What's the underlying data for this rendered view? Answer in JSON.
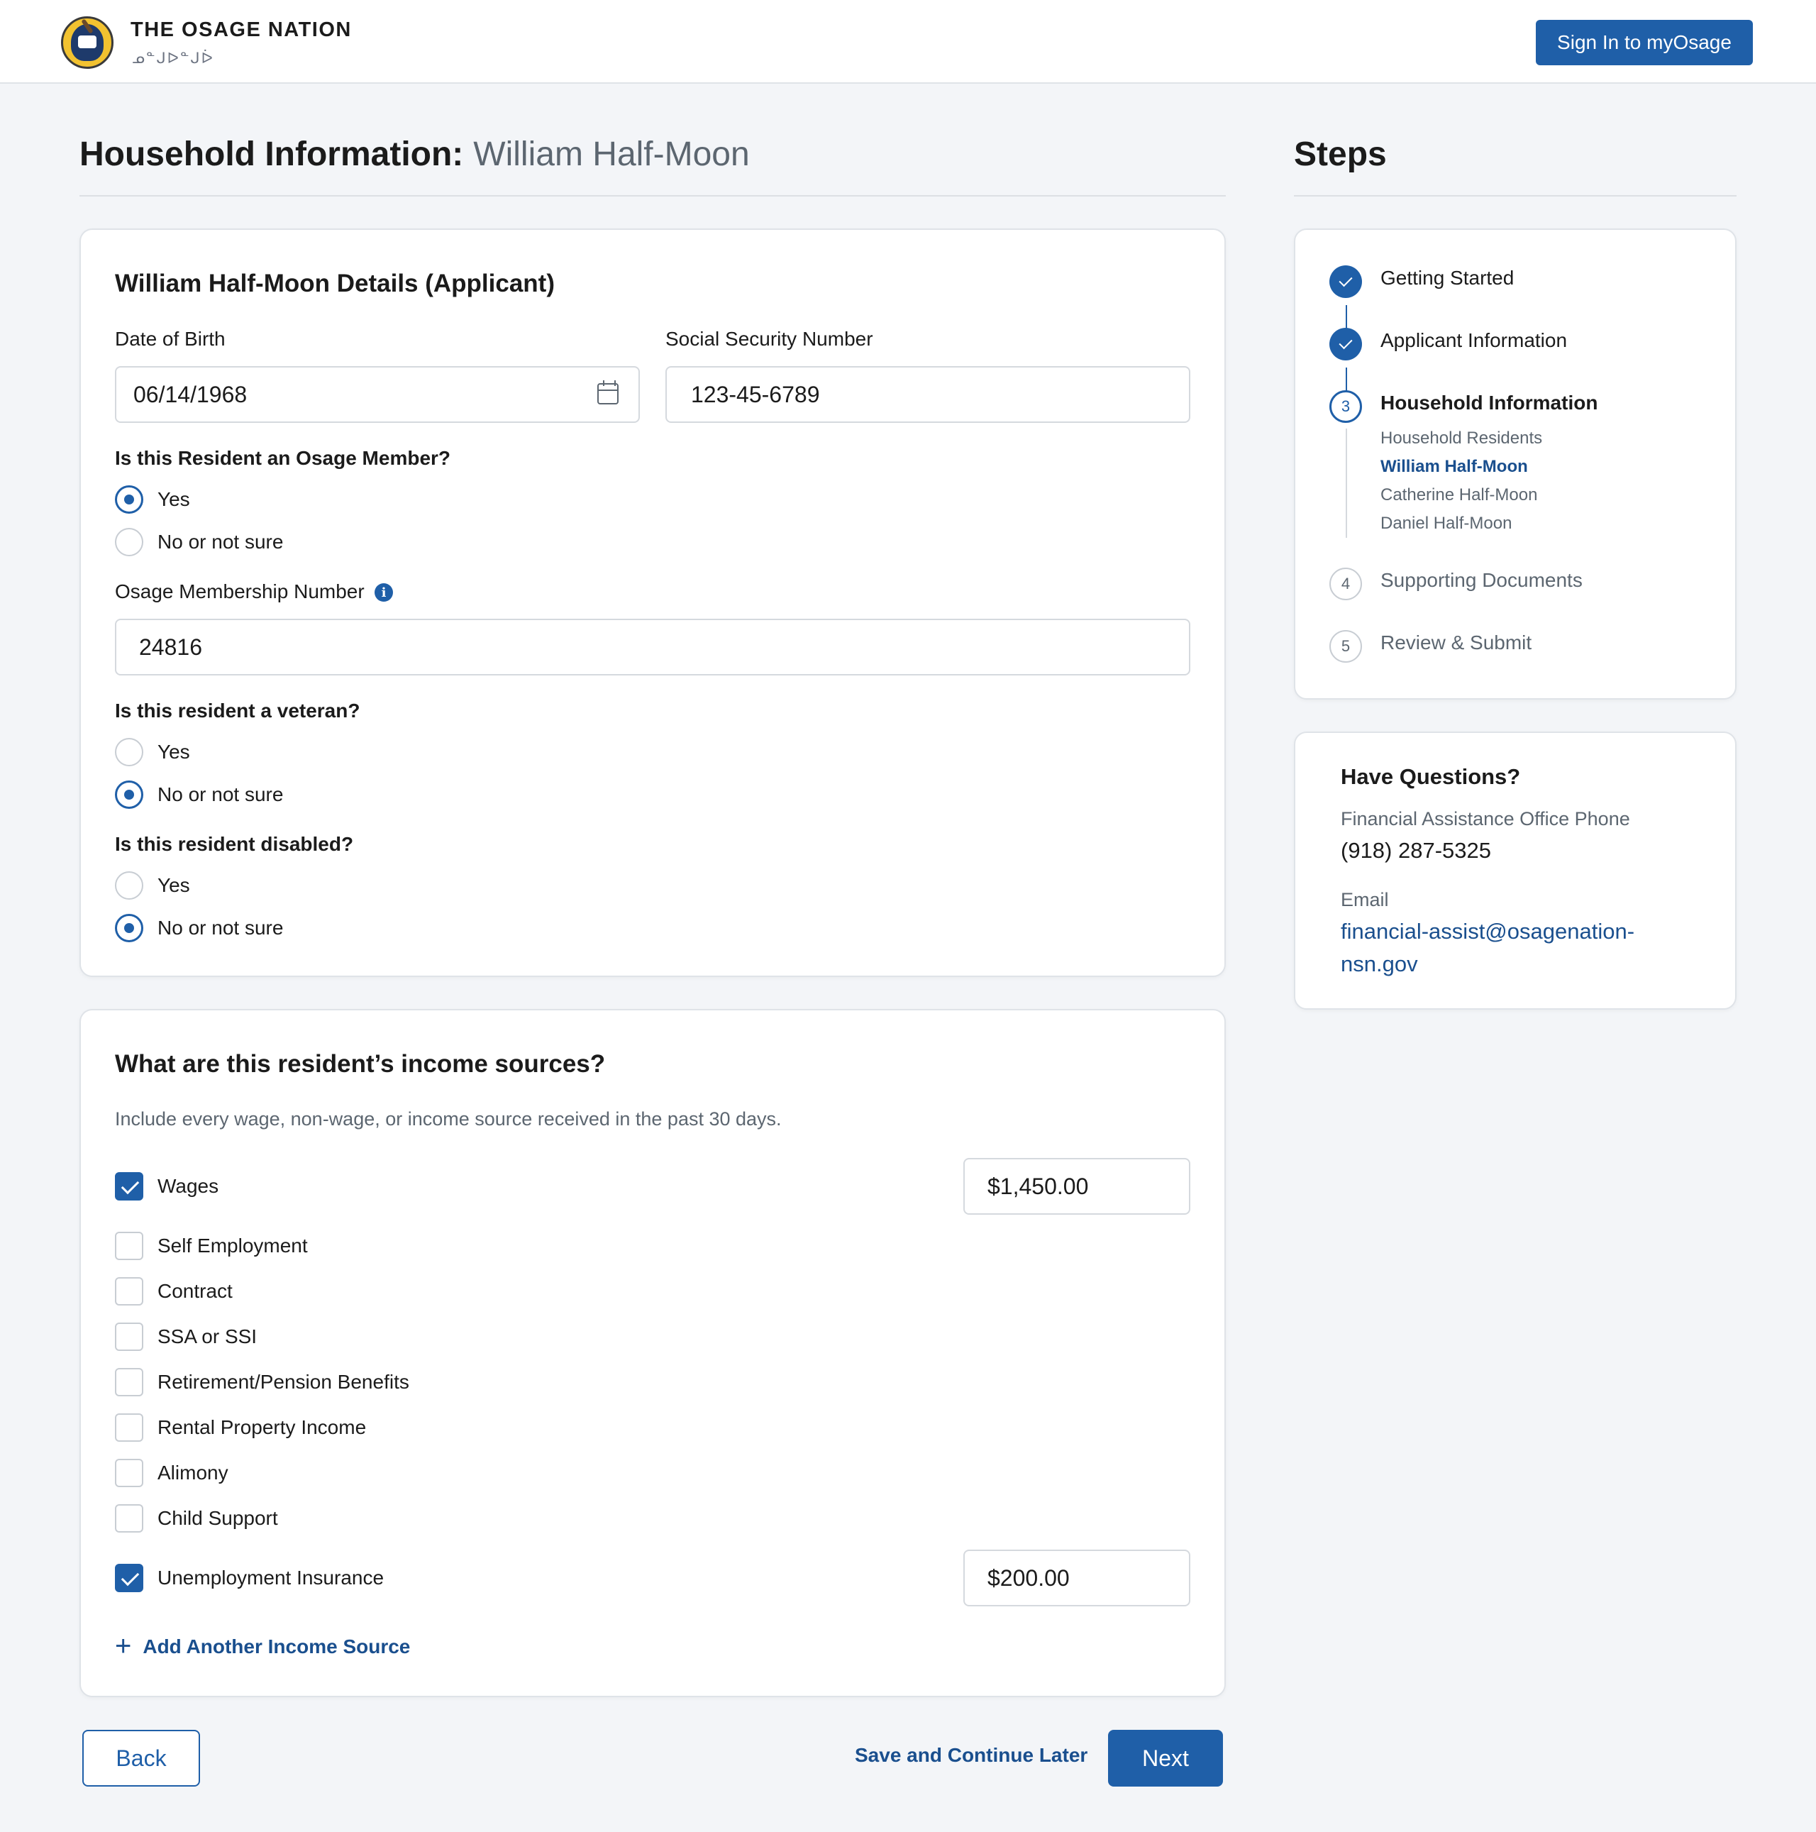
{
  "header": {
    "brand_name": "THE OSAGE NATION",
    "brand_sub": "ᓄᓐᒍᐅᓐᒍᐆ",
    "signin_label": "Sign In to myOsage"
  },
  "page": {
    "title": "Household Information:",
    "resident_name": "William Half-Moon",
    "steps_title": "Steps"
  },
  "details": {
    "heading": "William Half-Moon Details (Applicant)",
    "dob_label": "Date of Birth",
    "dob_value": "06/14/1968",
    "ssn_label": "Social Security Number",
    "ssn_value": "123-45-6789",
    "osage_question": "Is this Resident an Osage Member?",
    "opt_yes": "Yes",
    "opt_no": "No or not sure",
    "membership_label": "Osage Membership Number",
    "membership_value": "24816",
    "veteran_question": "Is this resident a veteran?",
    "disabled_question": "Is this resident disabled?"
  },
  "income": {
    "heading": "What are this resident’s income sources?",
    "hint": "Include every wage, non-wage, or income source received in the past 30 days.",
    "sources": [
      {
        "label": "Wages",
        "checked": true,
        "amount": "$1,450.00"
      },
      {
        "label": "Self Employment",
        "checked": false
      },
      {
        "label": "Contract",
        "checked": false
      },
      {
        "label": "SSA or SSI",
        "checked": false
      },
      {
        "label": "Retirement/Pension Benefits",
        "checked": false
      },
      {
        "label": "Rental Property Income",
        "checked": false
      },
      {
        "label": "Alimony",
        "checked": false
      },
      {
        "label": "Child Support",
        "checked": false
      },
      {
        "label": "Unemployment Insurance",
        "checked": true,
        "amount": "$200.00"
      }
    ],
    "add_label": "Add Another Income Source"
  },
  "steps": {
    "items": [
      {
        "label": "Getting Started",
        "state": "done"
      },
      {
        "label": "Applicant Information",
        "state": "done"
      },
      {
        "label": "Household Information",
        "state": "current",
        "number": "3"
      },
      {
        "label": "Supporting Documents",
        "state": "todo",
        "number": "4"
      },
      {
        "label": "Review & Submit",
        "state": "todo",
        "number": "5"
      }
    ],
    "sub_items": [
      "Household Residents",
      "William Half-Moon",
      "Catherine Half-Moon",
      "Daniel Half-Moon"
    ]
  },
  "help": {
    "heading": "Have Questions?",
    "phone_label": "Financial Assistance Office Phone",
    "phone": "(918) 287-5325",
    "email_label": "Email",
    "email_line1": "financial-assist@osagenation-",
    "email_line2": "nsn.gov"
  },
  "footer": {
    "back_label": "Back",
    "save_label": "Save and Continue Later",
    "next_label": "Next"
  },
  "colors": {
    "primary": "#1f5fa8",
    "link": "#1a4f8e",
    "background": "#f3f5f8"
  }
}
